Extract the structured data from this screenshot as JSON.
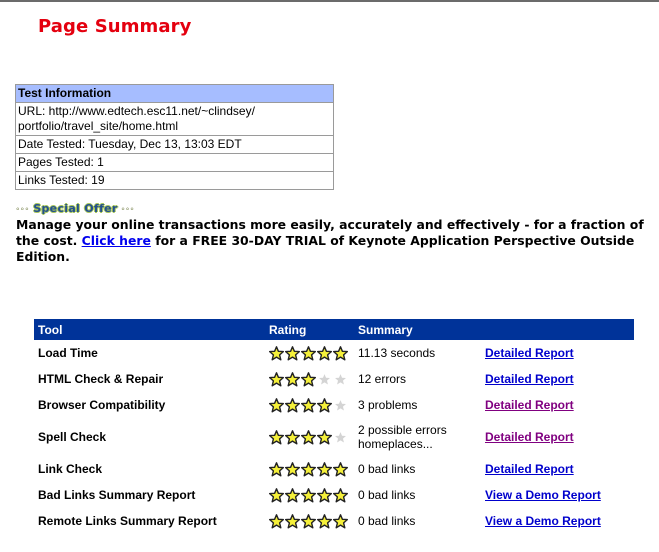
{
  "page_title": "Page Summary",
  "test_info": {
    "header": "Test Information",
    "url_line1": "URL: http://www.edtech.esc11.net/~clindsey/",
    "url_line2": "portfolio/travel_site/home.html",
    "date_tested": "Date Tested: Tuesday, Dec 13, 13:03 EDT",
    "pages_tested": "Pages Tested: 1",
    "links_tested": "Links Tested: 19"
  },
  "offer": {
    "dots": "◦◦◦",
    "label": "Special Offer",
    "text_before": "Manage your online transactions more easily, accurately and effectively - for a fraction of the cost. ",
    "link_text": "Click here",
    "text_after": " for a FREE 30-DAY TRIAL of Keynote Application Perspective Outside Edition."
  },
  "tools_table": {
    "headers": {
      "tool": "Tool",
      "rating": "Rating",
      "summary": "Summary"
    },
    "star_colors": {
      "filled": "#f5f03a",
      "outline": "#222222",
      "empty": "#d4d4d4"
    },
    "max_rating": 5,
    "rows": [
      {
        "tool": "Load Time",
        "rating": 5,
        "summary": "11.13 seconds",
        "summary2": "",
        "link": "Detailed Report",
        "visited": false
      },
      {
        "tool": "HTML Check & Repair",
        "rating": 3,
        "summary": "12 errors",
        "summary2": "",
        "link": "Detailed Report",
        "visited": false
      },
      {
        "tool": "Browser Compatibility",
        "rating": 4,
        "summary": "3 problems",
        "summary2": "",
        "link": "Detailed Report",
        "visited": true
      },
      {
        "tool": "Spell Check",
        "rating": 4,
        "summary": "2 possible errors",
        "summary2": "homeplaces...",
        "link": "Detailed Report",
        "visited": true
      },
      {
        "tool": "Link Check",
        "rating": 5,
        "summary": "0 bad links",
        "summary2": "",
        "link": "Detailed Report",
        "visited": false
      },
      {
        "tool": "Bad Links Summary Report",
        "rating": 5,
        "summary": "0 bad links",
        "summary2": "",
        "link": "View a Demo Report",
        "visited": false
      },
      {
        "tool": "Remote Links Summary Report",
        "rating": 5,
        "summary": "0 bad links",
        "summary2": "",
        "link": "View a Demo Report",
        "visited": false
      }
    ]
  }
}
